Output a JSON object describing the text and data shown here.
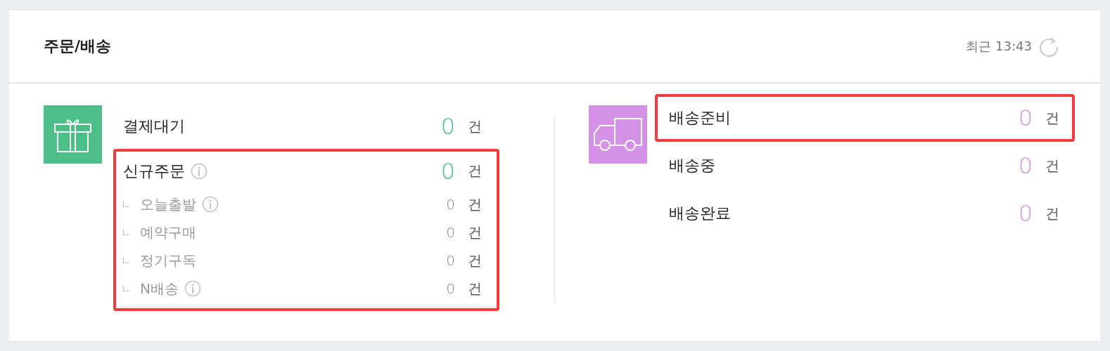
{
  "header": {
    "title": "주문/배송",
    "updated": "최근 13:43"
  },
  "sections": [
    {
      "kind": "gift",
      "color": "#4cbf88",
      "rows": [
        {
          "label": "결제대기",
          "count": "0",
          "unit": "건",
          "info": false,
          "highlighted": false
        },
        {
          "label": "신규주문",
          "count": "0",
          "unit": "건",
          "info": true,
          "highlighted": true,
          "children": [
            {
              "label": "오늘출발",
              "count": "0",
              "unit": "건",
              "info": true
            },
            {
              "label": "예약구매",
              "count": "0",
              "unit": "건",
              "info": false
            },
            {
              "label": "정기구독",
              "count": "0",
              "unit": "건",
              "info": false
            },
            {
              "label": "N배송",
              "count": "0",
              "unit": "건",
              "info": true
            }
          ]
        }
      ]
    },
    {
      "kind": "truck",
      "color": "#d392e5",
      "rows": [
        {
          "label": "배송준비",
          "count": "0",
          "unit": "건",
          "info": false,
          "highlighted": true
        },
        {
          "label": "배송중",
          "count": "0",
          "unit": "건",
          "info": false,
          "highlighted": false
        },
        {
          "label": "배송완료",
          "count": "0",
          "unit": "건",
          "info": false,
          "highlighted": false
        }
      ]
    }
  ]
}
